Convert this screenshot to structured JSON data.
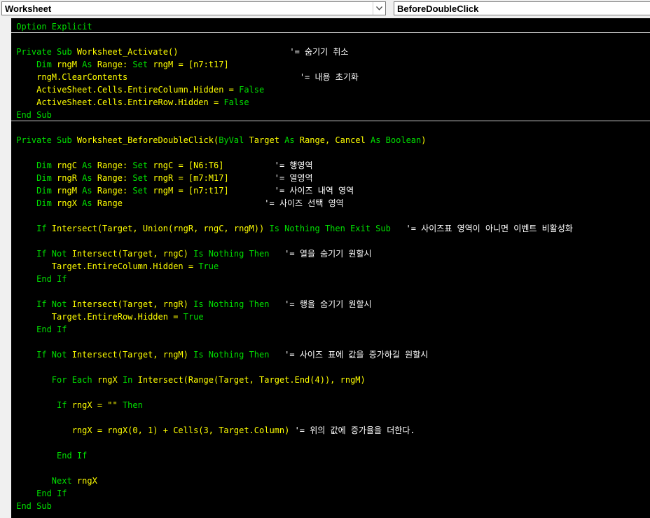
{
  "object_combo": {
    "value": "Worksheet"
  },
  "procedure_combo": {
    "value": "BeforeDoubleClick"
  },
  "code_lines": [
    [
      {
        "t": "kw",
        "s": " Option Explicit"
      }
    ],
    [],
    [
      {
        "t": "kw",
        "s": " Private Sub "
      },
      {
        "t": "tx",
        "s": "Worksheet_Activate()                      "
      },
      {
        "t": "cm",
        "s": "'= 숨기기 취소"
      }
    ],
    [
      {
        "t": "kw",
        "s": "     Dim "
      },
      {
        "t": "tx",
        "s": "rngM "
      },
      {
        "t": "kw",
        "s": "As "
      },
      {
        "t": "tx",
        "s": "Range: "
      },
      {
        "t": "kw",
        "s": "Set "
      },
      {
        "t": "tx",
        "s": "rngM = [n7:t17]"
      }
    ],
    [
      {
        "t": "tx",
        "s": "     rngM.ClearContents                                  "
      },
      {
        "t": "cm",
        "s": "'= 내용 초기화"
      }
    ],
    [
      {
        "t": "tx",
        "s": "     ActiveSheet.Cells.EntireColumn.Hidden = "
      },
      {
        "t": "kw",
        "s": "False"
      }
    ],
    [
      {
        "t": "tx",
        "s": "     ActiveSheet.Cells.EntireRow.Hidden = "
      },
      {
        "t": "kw",
        "s": "False"
      }
    ],
    [
      {
        "t": "kw",
        "s": " End Sub"
      }
    ],
    [],
    [
      {
        "t": "kw",
        "s": " Private Sub "
      },
      {
        "t": "tx",
        "s": "Worksheet_BeforeDoubleClick("
      },
      {
        "t": "kw",
        "s": "ByVal "
      },
      {
        "t": "tx",
        "s": "Target "
      },
      {
        "t": "kw",
        "s": "As "
      },
      {
        "t": "tx",
        "s": "Range, Cancel "
      },
      {
        "t": "kw",
        "s": "As Boolean"
      },
      {
        "t": "tx",
        "s": ")"
      }
    ],
    [],
    [
      {
        "t": "kw",
        "s": "     Dim "
      },
      {
        "t": "tx",
        "s": "rngC "
      },
      {
        "t": "kw",
        "s": "As "
      },
      {
        "t": "tx",
        "s": "Range: "
      },
      {
        "t": "kw",
        "s": "Set "
      },
      {
        "t": "tx",
        "s": "rngC = [N6:T6]          "
      },
      {
        "t": "cm",
        "s": "'= 행영역"
      }
    ],
    [
      {
        "t": "kw",
        "s": "     Dim "
      },
      {
        "t": "tx",
        "s": "rngR "
      },
      {
        "t": "kw",
        "s": "As "
      },
      {
        "t": "tx",
        "s": "Range: "
      },
      {
        "t": "kw",
        "s": "Set "
      },
      {
        "t": "tx",
        "s": "rngR = [m7:M17]         "
      },
      {
        "t": "cm",
        "s": "'= 열영역"
      }
    ],
    [
      {
        "t": "kw",
        "s": "     Dim "
      },
      {
        "t": "tx",
        "s": "rngM "
      },
      {
        "t": "kw",
        "s": "As "
      },
      {
        "t": "tx",
        "s": "Range: "
      },
      {
        "t": "kw",
        "s": "Set "
      },
      {
        "t": "tx",
        "s": "rngM = [n7:t17]         "
      },
      {
        "t": "cm",
        "s": "'= 사이즈 내역 영역"
      }
    ],
    [
      {
        "t": "kw",
        "s": "     Dim "
      },
      {
        "t": "tx",
        "s": "rngX "
      },
      {
        "t": "kw",
        "s": "As "
      },
      {
        "t": "tx",
        "s": "Range                            "
      },
      {
        "t": "cm",
        "s": "'= 사이즈 선택 영역"
      }
    ],
    [],
    [
      {
        "t": "kw",
        "s": "     If "
      },
      {
        "t": "tx",
        "s": "Intersect(Target, Union(rngR, rngC, rngM)) "
      },
      {
        "t": "kw",
        "s": "Is Nothing Then Exit Sub"
      },
      {
        "t": "tx",
        "s": "   "
      },
      {
        "t": "cm",
        "s": "'= 사이즈표 영역이 아니면 이벤트 비활성화"
      }
    ],
    [],
    [
      {
        "t": "kw",
        "s": "     If Not "
      },
      {
        "t": "tx",
        "s": "Intersect(Target, rngC) "
      },
      {
        "t": "kw",
        "s": "Is Nothing Then"
      },
      {
        "t": "tx",
        "s": "   "
      },
      {
        "t": "cm",
        "s": "'= 열을 숨기기 원할시"
      }
    ],
    [
      {
        "t": "tx",
        "s": "        Target.EntireColumn.Hidden = "
      },
      {
        "t": "kw",
        "s": "True"
      }
    ],
    [
      {
        "t": "kw",
        "s": "     End If"
      }
    ],
    [],
    [
      {
        "t": "kw",
        "s": "     If Not "
      },
      {
        "t": "tx",
        "s": "Intersect(Target, rngR) "
      },
      {
        "t": "kw",
        "s": "Is Nothing Then"
      },
      {
        "t": "tx",
        "s": "   "
      },
      {
        "t": "cm",
        "s": "'= 행을 숨기기 원할시"
      }
    ],
    [
      {
        "t": "tx",
        "s": "        Target.EntireRow.Hidden = "
      },
      {
        "t": "kw",
        "s": "True"
      }
    ],
    [
      {
        "t": "kw",
        "s": "     End If"
      }
    ],
    [],
    [
      {
        "t": "kw",
        "s": "     If Not "
      },
      {
        "t": "tx",
        "s": "Intersect(Target, rngM) "
      },
      {
        "t": "kw",
        "s": "Is Nothing Then"
      },
      {
        "t": "tx",
        "s": "   "
      },
      {
        "t": "cm",
        "s": "'= 사이즈 표에 값을 증가하길 원할시"
      }
    ],
    [],
    [
      {
        "t": "kw",
        "s": "        For Each "
      },
      {
        "t": "tx",
        "s": "rngX "
      },
      {
        "t": "kw",
        "s": "In "
      },
      {
        "t": "tx",
        "s": "Intersect(Range(Target, Target.End(4)), rngM)"
      }
    ],
    [],
    [
      {
        "t": "kw",
        "s": "         If "
      },
      {
        "t": "tx",
        "s": "rngX = \"\" "
      },
      {
        "t": "kw",
        "s": "Then"
      }
    ],
    [],
    [
      {
        "t": "tx",
        "s": "            rngX = rngX(0, 1) + Cells(3, Target.Column) "
      },
      {
        "t": "cm",
        "s": "'= 위의 값에 증가율을 더한다."
      }
    ],
    [],
    [
      {
        "t": "kw",
        "s": "         End If"
      }
    ],
    [],
    [
      {
        "t": "kw",
        "s": "        Next "
      },
      {
        "t": "tx",
        "s": "rngX"
      }
    ],
    [
      {
        "t": "kw",
        "s": "     End If"
      }
    ],
    [
      {
        "t": "kw",
        "s": " End Sub"
      }
    ]
  ],
  "colors": {
    "keyword": "#00e000",
    "text": "#ffff00",
    "comment": "#ffffff",
    "background": "#000000"
  }
}
